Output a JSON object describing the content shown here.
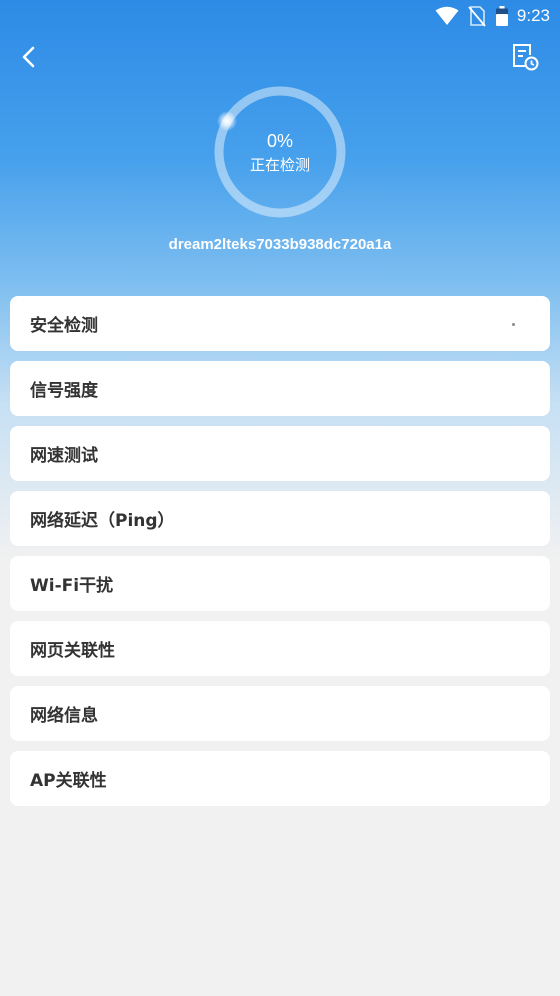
{
  "status_bar": {
    "time": "9:23",
    "icons": [
      "wifi-icon",
      "no-sim-icon",
      "battery-icon"
    ]
  },
  "header": {
    "back_icon": "chevron-left-icon",
    "history_icon": "document-clock-icon"
  },
  "gauge": {
    "percent": "0%",
    "progress": 0,
    "status": "正在检测"
  },
  "device_name": "dream2lteks7033b938dc720a1a",
  "checks": [
    {
      "label": "安全检测",
      "loading": true
    },
    {
      "label": "信号强度"
    },
    {
      "label": "网速测试"
    },
    {
      "label": "网络延迟（Ping）"
    },
    {
      "label": "Wi-Fi干扰"
    },
    {
      "label": "网页关联性"
    },
    {
      "label": "网络信息"
    },
    {
      "label": "AP关联性"
    }
  ],
  "colors": {
    "header_top": "#2d8be6",
    "background": "#f1f1f1",
    "card": "#ffffff",
    "text": "#333333"
  }
}
